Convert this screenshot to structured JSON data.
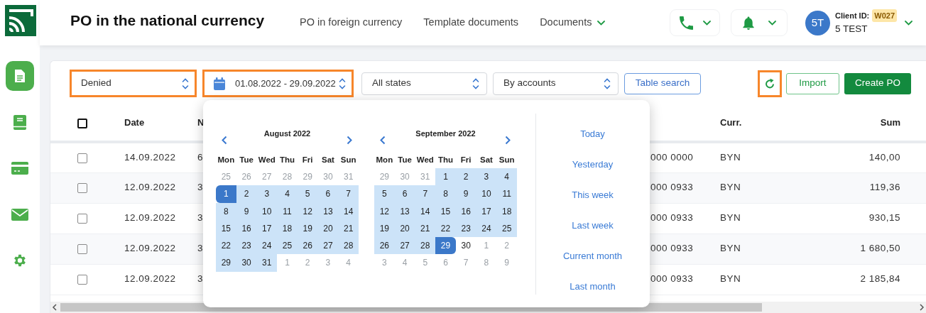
{
  "sidebar": {
    "items": [
      {
        "kind": "document",
        "selected": true
      },
      {
        "kind": "book",
        "selected": false
      },
      {
        "kind": "card",
        "selected": false
      },
      {
        "kind": "mail",
        "selected": false
      },
      {
        "kind": "settings",
        "selected": false
      }
    ]
  },
  "header": {
    "title": "PO in the national currency",
    "nav": [
      {
        "label": "PO in foreign currency",
        "has_menu": false
      },
      {
        "label": "Template documents",
        "has_menu": false
      },
      {
        "label": "Documents",
        "has_menu": true
      }
    ],
    "user": {
      "avatar": "5T",
      "client_id_label": "Client ID:",
      "client_id": "W027",
      "name": "5 TEST"
    }
  },
  "toolbar": {
    "filters": [
      {
        "kind": "select",
        "value": "Denied",
        "highlighted": true
      },
      {
        "kind": "date",
        "value": "01.08.2022 - 29.09.2022",
        "highlighted": true
      },
      {
        "kind": "select",
        "value": "All states",
        "highlighted": false
      },
      {
        "kind": "select",
        "value": "By accounts",
        "highlighted": false
      }
    ],
    "search_button": "Table search",
    "refresh_highlighted": true,
    "import_button": "Import",
    "create_button": "Create PO"
  },
  "table": {
    "select_all_checked": false,
    "columns": [
      "Date",
      "N",
      "Curr.",
      "Sum"
    ],
    "rows": [
      {
        "checked": false,
        "date": "14.09.2022",
        "number": "6",
        "column_4": "000 0000",
        "currency": "BYN",
        "sum": "140,00"
      },
      {
        "checked": false,
        "date": "12.09.2022",
        "number": "3",
        "column_4": "000 0933",
        "currency": "BYN",
        "sum": "119,36"
      },
      {
        "checked": false,
        "date": "12.09.2022",
        "number": "3",
        "column_4": "000 0933",
        "currency": "BYN",
        "sum": "930,15"
      },
      {
        "checked": false,
        "date": "12.09.2022",
        "number": "3",
        "column_4": "000 0933",
        "currency": "BYN",
        "sum": "1 680,50"
      },
      {
        "checked": false,
        "date": "12.09.2022",
        "number": "3",
        "column_4": "000 0933",
        "currency": "BYN",
        "sum": "2 185,84"
      }
    ]
  },
  "datepicker": {
    "calendars": [
      {
        "title": "August 2022",
        "weekdays": [
          "Mon",
          "Tue",
          "Wed",
          "Thu",
          "Fri",
          "Sat",
          "Sun"
        ],
        "days": [
          {
            "label": "25",
            "outside": true,
            "in_range": false,
            "selected": false
          },
          {
            "label": "26",
            "outside": true,
            "in_range": false,
            "selected": false
          },
          {
            "label": "27",
            "outside": true,
            "in_range": false,
            "selected": false
          },
          {
            "label": "28",
            "outside": true,
            "in_range": false,
            "selected": false
          },
          {
            "label": "29",
            "outside": true,
            "in_range": false,
            "selected": false
          },
          {
            "label": "30",
            "outside": true,
            "in_range": false,
            "selected": false
          },
          {
            "label": "31",
            "outside": true,
            "in_range": false,
            "selected": false
          },
          {
            "label": "1",
            "outside": false,
            "in_range": true,
            "selected": true
          },
          {
            "label": "2",
            "outside": false,
            "in_range": true,
            "selected": false
          },
          {
            "label": "3",
            "outside": false,
            "in_range": true,
            "selected": false
          },
          {
            "label": "4",
            "outside": false,
            "in_range": true,
            "selected": false
          },
          {
            "label": "5",
            "outside": false,
            "in_range": true,
            "selected": false
          },
          {
            "label": "6",
            "outside": false,
            "in_range": true,
            "selected": false
          },
          {
            "label": "7",
            "outside": false,
            "in_range": true,
            "selected": false
          },
          {
            "label": "8",
            "outside": false,
            "in_range": true,
            "selected": false
          },
          {
            "label": "9",
            "outside": false,
            "in_range": true,
            "selected": false
          },
          {
            "label": "10",
            "outside": false,
            "in_range": true,
            "selected": false
          },
          {
            "label": "11",
            "outside": false,
            "in_range": true,
            "selected": false
          },
          {
            "label": "12",
            "outside": false,
            "in_range": true,
            "selected": false
          },
          {
            "label": "13",
            "outside": false,
            "in_range": true,
            "selected": false
          },
          {
            "label": "14",
            "outside": false,
            "in_range": true,
            "selected": false
          },
          {
            "label": "15",
            "outside": false,
            "in_range": true,
            "selected": false
          },
          {
            "label": "16",
            "outside": false,
            "in_range": true,
            "selected": false
          },
          {
            "label": "17",
            "outside": false,
            "in_range": true,
            "selected": false
          },
          {
            "label": "18",
            "outside": false,
            "in_range": true,
            "selected": false
          },
          {
            "label": "19",
            "outside": false,
            "in_range": true,
            "selected": false
          },
          {
            "label": "20",
            "outside": false,
            "in_range": true,
            "selected": false
          },
          {
            "label": "21",
            "outside": false,
            "in_range": true,
            "selected": false
          },
          {
            "label": "22",
            "outside": false,
            "in_range": true,
            "selected": false
          },
          {
            "label": "23",
            "outside": false,
            "in_range": true,
            "selected": false
          },
          {
            "label": "24",
            "outside": false,
            "in_range": true,
            "selected": false
          },
          {
            "label": "25",
            "outside": false,
            "in_range": true,
            "selected": false
          },
          {
            "label": "26",
            "outside": false,
            "in_range": true,
            "selected": false
          },
          {
            "label": "27",
            "outside": false,
            "in_range": true,
            "selected": false
          },
          {
            "label": "28",
            "outside": false,
            "in_range": true,
            "selected": false
          },
          {
            "label": "29",
            "outside": false,
            "in_range": true,
            "selected": false
          },
          {
            "label": "30",
            "outside": false,
            "in_range": true,
            "selected": false
          },
          {
            "label": "31",
            "outside": false,
            "in_range": true,
            "selected": false
          },
          {
            "label": "1",
            "outside": true,
            "in_range": false,
            "selected": false
          },
          {
            "label": "2",
            "outside": true,
            "in_range": false,
            "selected": false
          },
          {
            "label": "3",
            "outside": true,
            "in_range": false,
            "selected": false
          },
          {
            "label": "4",
            "outside": true,
            "in_range": false,
            "selected": false
          }
        ]
      },
      {
        "title": "September 2022",
        "weekdays": [
          "Mon",
          "Tue",
          "Wed",
          "Thu",
          "Fri",
          "Sat",
          "Sun"
        ],
        "days": [
          {
            "label": "29",
            "outside": true,
            "in_range": false,
            "selected": false
          },
          {
            "label": "30",
            "outside": true,
            "in_range": false,
            "selected": false
          },
          {
            "label": "31",
            "outside": true,
            "in_range": false,
            "selected": false
          },
          {
            "label": "1",
            "outside": false,
            "in_range": true,
            "selected": false
          },
          {
            "label": "2",
            "outside": false,
            "in_range": true,
            "selected": false
          },
          {
            "label": "3",
            "outside": false,
            "in_range": true,
            "selected": false
          },
          {
            "label": "4",
            "outside": false,
            "in_range": true,
            "selected": false
          },
          {
            "label": "5",
            "outside": false,
            "in_range": true,
            "selected": false
          },
          {
            "label": "6",
            "outside": false,
            "in_range": true,
            "selected": false
          },
          {
            "label": "7",
            "outside": false,
            "in_range": true,
            "selected": false
          },
          {
            "label": "8",
            "outside": false,
            "in_range": true,
            "selected": false
          },
          {
            "label": "9",
            "outside": false,
            "in_range": true,
            "selected": false
          },
          {
            "label": "10",
            "outside": false,
            "in_range": true,
            "selected": false
          },
          {
            "label": "11",
            "outside": false,
            "in_range": true,
            "selected": false
          },
          {
            "label": "12",
            "outside": false,
            "in_range": true,
            "selected": false
          },
          {
            "label": "13",
            "outside": false,
            "in_range": true,
            "selected": false
          },
          {
            "label": "14",
            "outside": false,
            "in_range": true,
            "selected": false
          },
          {
            "label": "15",
            "outside": false,
            "in_range": true,
            "selected": false
          },
          {
            "label": "16",
            "outside": false,
            "in_range": true,
            "selected": false
          },
          {
            "label": "17",
            "outside": false,
            "in_range": true,
            "selected": false
          },
          {
            "label": "18",
            "outside": false,
            "in_range": true,
            "selected": false
          },
          {
            "label": "19",
            "outside": false,
            "in_range": true,
            "selected": false
          },
          {
            "label": "20",
            "outside": false,
            "in_range": true,
            "selected": false
          },
          {
            "label": "21",
            "outside": false,
            "in_range": true,
            "selected": false
          },
          {
            "label": "22",
            "outside": false,
            "in_range": true,
            "selected": false
          },
          {
            "label": "23",
            "outside": false,
            "in_range": true,
            "selected": false
          },
          {
            "label": "24",
            "outside": false,
            "in_range": true,
            "selected": false
          },
          {
            "label": "25",
            "outside": false,
            "in_range": true,
            "selected": false
          },
          {
            "label": "26",
            "outside": false,
            "in_range": true,
            "selected": false
          },
          {
            "label": "27",
            "outside": false,
            "in_range": true,
            "selected": false
          },
          {
            "label": "28",
            "outside": false,
            "in_range": true,
            "selected": false
          },
          {
            "label": "29",
            "outside": false,
            "in_range": true,
            "selected": true
          },
          {
            "label": "30",
            "outside": false,
            "in_range": false,
            "selected": false
          },
          {
            "label": "1",
            "outside": true,
            "in_range": false,
            "selected": false
          },
          {
            "label": "2",
            "outside": true,
            "in_range": false,
            "selected": false
          },
          {
            "label": "3",
            "outside": true,
            "in_range": false,
            "selected": false
          },
          {
            "label": "4",
            "outside": true,
            "in_range": false,
            "selected": false
          },
          {
            "label": "5",
            "outside": true,
            "in_range": false,
            "selected": false
          },
          {
            "label": "6",
            "outside": true,
            "in_range": false,
            "selected": false
          },
          {
            "label": "7",
            "outside": true,
            "in_range": false,
            "selected": false
          },
          {
            "label": "8",
            "outside": true,
            "in_range": false,
            "selected": false
          },
          {
            "label": "9",
            "outside": true,
            "in_range": false,
            "selected": false
          }
        ]
      }
    ],
    "presets": [
      "Today",
      "Yesterday",
      "This week",
      "Last week",
      "Current month",
      "Last month"
    ]
  }
}
